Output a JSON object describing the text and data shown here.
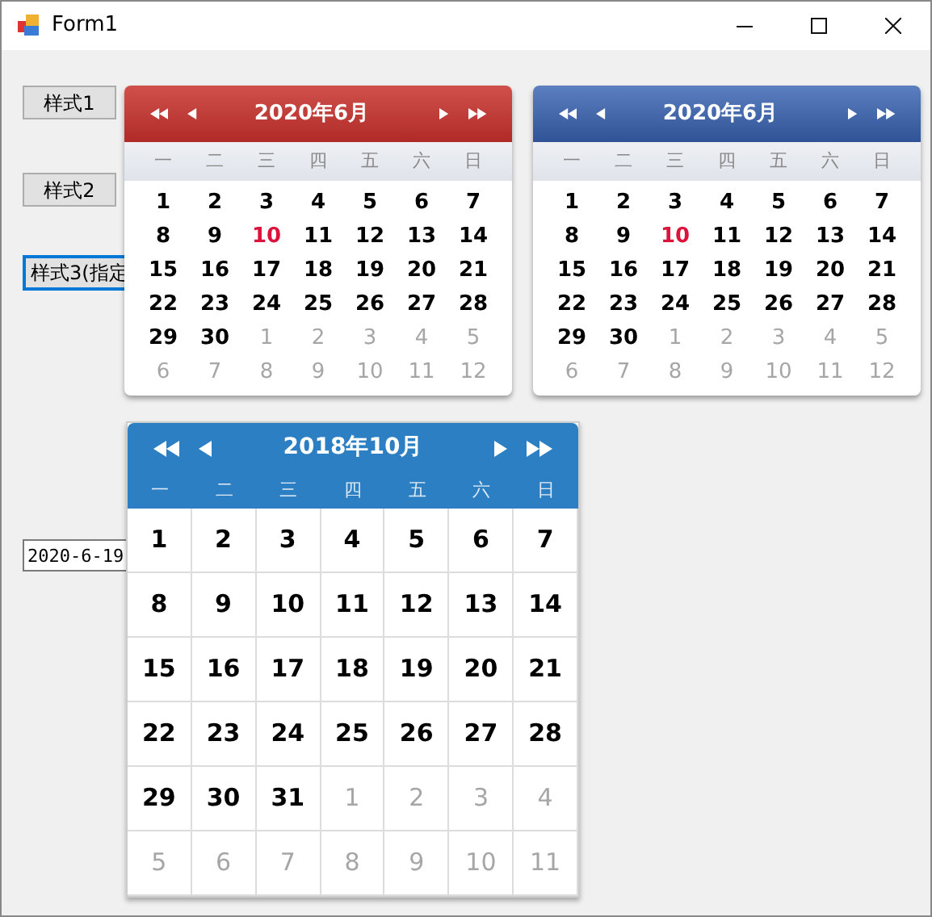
{
  "window": {
    "title": "Form1"
  },
  "buttons": [
    "样式1",
    "样式2"
  ],
  "focused_button": {
    "label": "样式3(指定",
    "focused": true
  },
  "date_field": {
    "value": "2020-6-19"
  },
  "calendars": [
    {
      "kind": "red",
      "title": "2020年6月",
      "weekdays": [
        "一",
        "二",
        "三",
        "四",
        "五",
        "六",
        "日"
      ],
      "days": [
        {
          "text": "1",
          "kind": "in"
        },
        {
          "text": "2",
          "kind": "in"
        },
        {
          "text": "3",
          "kind": "in"
        },
        {
          "text": "4",
          "kind": "in"
        },
        {
          "text": "5",
          "kind": "in"
        },
        {
          "text": "6",
          "kind": "in"
        },
        {
          "text": "7",
          "kind": "in"
        },
        {
          "text": "8",
          "kind": "in"
        },
        {
          "text": "9",
          "kind": "in"
        },
        {
          "text": "10",
          "kind": "today"
        },
        {
          "text": "11",
          "kind": "in"
        },
        {
          "text": "12",
          "kind": "in"
        },
        {
          "text": "13",
          "kind": "in"
        },
        {
          "text": "14",
          "kind": "in"
        },
        {
          "text": "15",
          "kind": "in"
        },
        {
          "text": "16",
          "kind": "in"
        },
        {
          "text": "17",
          "kind": "in"
        },
        {
          "text": "18",
          "kind": "in"
        },
        {
          "text": "19",
          "kind": "in"
        },
        {
          "text": "20",
          "kind": "in"
        },
        {
          "text": "21",
          "kind": "in"
        },
        {
          "text": "22",
          "kind": "in"
        },
        {
          "text": "23",
          "kind": "in"
        },
        {
          "text": "24",
          "kind": "in"
        },
        {
          "text": "25",
          "kind": "in"
        },
        {
          "text": "26",
          "kind": "in"
        },
        {
          "text": "27",
          "kind": "in"
        },
        {
          "text": "28",
          "kind": "in"
        },
        {
          "text": "29",
          "kind": "in"
        },
        {
          "text": "30",
          "kind": "in"
        },
        {
          "text": "1",
          "kind": "out"
        },
        {
          "text": "2",
          "kind": "out"
        },
        {
          "text": "3",
          "kind": "out"
        },
        {
          "text": "4",
          "kind": "out"
        },
        {
          "text": "5",
          "kind": "out"
        },
        {
          "text": "6",
          "kind": "out"
        },
        {
          "text": "7",
          "kind": "out"
        },
        {
          "text": "8",
          "kind": "out"
        },
        {
          "text": "9",
          "kind": "out"
        },
        {
          "text": "10",
          "kind": "out"
        },
        {
          "text": "11",
          "kind": "out"
        },
        {
          "text": "12",
          "kind": "out"
        }
      ]
    },
    {
      "kind": "blue",
      "title": "2020年6月",
      "weekdays": [
        "一",
        "二",
        "三",
        "四",
        "五",
        "六",
        "日"
      ],
      "days": [
        {
          "text": "1",
          "kind": "in"
        },
        {
          "text": "2",
          "kind": "in"
        },
        {
          "text": "3",
          "kind": "in"
        },
        {
          "text": "4",
          "kind": "in"
        },
        {
          "text": "5",
          "kind": "in"
        },
        {
          "text": "6",
          "kind": "in"
        },
        {
          "text": "7",
          "kind": "in"
        },
        {
          "text": "8",
          "kind": "in"
        },
        {
          "text": "9",
          "kind": "in"
        },
        {
          "text": "10",
          "kind": "today"
        },
        {
          "text": "11",
          "kind": "in"
        },
        {
          "text": "12",
          "kind": "in"
        },
        {
          "text": "13",
          "kind": "in"
        },
        {
          "text": "14",
          "kind": "in"
        },
        {
          "text": "15",
          "kind": "in"
        },
        {
          "text": "16",
          "kind": "in"
        },
        {
          "text": "17",
          "kind": "in"
        },
        {
          "text": "18",
          "kind": "in"
        },
        {
          "text": "19",
          "kind": "in"
        },
        {
          "text": "20",
          "kind": "in"
        },
        {
          "text": "21",
          "kind": "in"
        },
        {
          "text": "22",
          "kind": "in"
        },
        {
          "text": "23",
          "kind": "in"
        },
        {
          "text": "24",
          "kind": "in"
        },
        {
          "text": "25",
          "kind": "in"
        },
        {
          "text": "26",
          "kind": "in"
        },
        {
          "text": "27",
          "kind": "in"
        },
        {
          "text": "28",
          "kind": "in"
        },
        {
          "text": "29",
          "kind": "in"
        },
        {
          "text": "30",
          "kind": "in"
        },
        {
          "text": "1",
          "kind": "out"
        },
        {
          "text": "2",
          "kind": "out"
        },
        {
          "text": "3",
          "kind": "out"
        },
        {
          "text": "4",
          "kind": "out"
        },
        {
          "text": "5",
          "kind": "out"
        },
        {
          "text": "6",
          "kind": "out"
        },
        {
          "text": "7",
          "kind": "out"
        },
        {
          "text": "8",
          "kind": "out"
        },
        {
          "text": "9",
          "kind": "out"
        },
        {
          "text": "10",
          "kind": "out"
        },
        {
          "text": "11",
          "kind": "out"
        },
        {
          "text": "12",
          "kind": "out"
        }
      ]
    },
    {
      "kind": "flat",
      "title": "2018年10月",
      "weekdays": [
        "一",
        "二",
        "三",
        "四",
        "五",
        "六",
        "日"
      ],
      "days": [
        {
          "text": "1",
          "kind": "in"
        },
        {
          "text": "2",
          "kind": "in"
        },
        {
          "text": "3",
          "kind": "in"
        },
        {
          "text": "4",
          "kind": "in"
        },
        {
          "text": "5",
          "kind": "in"
        },
        {
          "text": "6",
          "kind": "in"
        },
        {
          "text": "7",
          "kind": "in"
        },
        {
          "text": "8",
          "kind": "in"
        },
        {
          "text": "9",
          "kind": "in"
        },
        {
          "text": "10",
          "kind": "in"
        },
        {
          "text": "11",
          "kind": "in"
        },
        {
          "text": "12",
          "kind": "in"
        },
        {
          "text": "13",
          "kind": "in"
        },
        {
          "text": "14",
          "kind": "in"
        },
        {
          "text": "15",
          "kind": "in"
        },
        {
          "text": "16",
          "kind": "in"
        },
        {
          "text": "17",
          "kind": "in"
        },
        {
          "text": "18",
          "kind": "in"
        },
        {
          "text": "19",
          "kind": "in"
        },
        {
          "text": "20",
          "kind": "in"
        },
        {
          "text": "21",
          "kind": "in"
        },
        {
          "text": "22",
          "kind": "in"
        },
        {
          "text": "23",
          "kind": "in"
        },
        {
          "text": "24",
          "kind": "in"
        },
        {
          "text": "25",
          "kind": "in"
        },
        {
          "text": "26",
          "kind": "in"
        },
        {
          "text": "27",
          "kind": "in"
        },
        {
          "text": "28",
          "kind": "in"
        },
        {
          "text": "29",
          "kind": "in"
        },
        {
          "text": "30",
          "kind": "in"
        },
        {
          "text": "31",
          "kind": "in"
        },
        {
          "text": "1",
          "kind": "out"
        },
        {
          "text": "2",
          "kind": "out"
        },
        {
          "text": "3",
          "kind": "out"
        },
        {
          "text": "4",
          "kind": "out"
        },
        {
          "text": "5",
          "kind": "out"
        },
        {
          "text": "6",
          "kind": "out"
        },
        {
          "text": "7",
          "kind": "out"
        },
        {
          "text": "8",
          "kind": "out"
        },
        {
          "text": "9",
          "kind": "out"
        },
        {
          "text": "10",
          "kind": "out"
        },
        {
          "text": "11",
          "kind": "out"
        }
      ]
    }
  ]
}
